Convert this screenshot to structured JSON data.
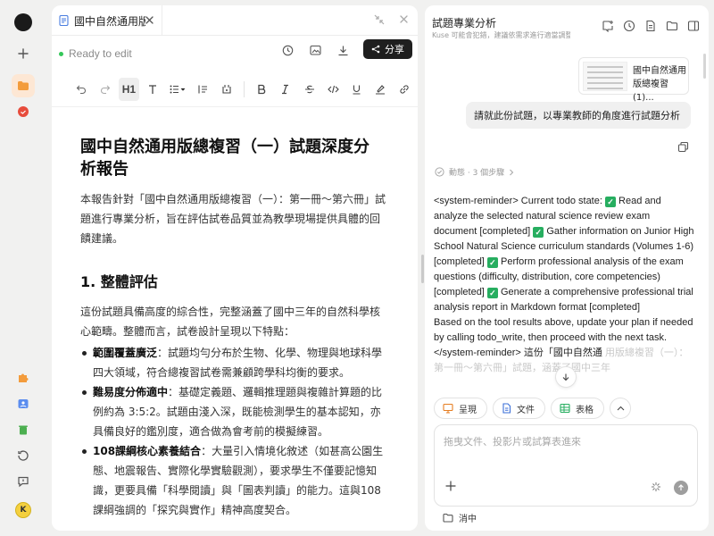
{
  "colors": {
    "accent_orange": "#f39c3c",
    "accent_red": "#e74c3c",
    "ready_green": "#34c759",
    "check_green": "#27ae60"
  },
  "rail": {
    "avatar_letter": "K"
  },
  "editor": {
    "tab_title": "國中自然通用版總複習（一）試題深度分析報告",
    "status": "Ready to edit",
    "share_label": "分享",
    "heading_selector": "H1",
    "doc": {
      "title": "國中自然通用版總複習（一）試題深度分析報告",
      "intro": "本報告針對「國中自然通用版總複習（一）：第一冊～第六冊」試題進行專業分析，旨在評估試卷品質並為教學現場提供具體的回饋建議。",
      "section1_title": "1. 整體評估",
      "section1_p": "這份試題具備高度的綜合性，完整涵蓋了國中三年的自然科學核心範疇。整體而言，試卷設計呈現以下特點：",
      "bullets": [
        {
          "bold": "範圍覆蓋廣泛",
          "text": "：試題均勻分布於生物、化學、物理與地球科學四大領域，符合總複習試卷需兼顧跨學科均衡的要求。"
        },
        {
          "bold": "難易度分佈適中",
          "text": "：基礎定義題、邏輯推理題與複雜計算題的比例約為 3:5:2。試題由淺入深，既能檢測學生的基本認知，亦具備良好的鑑別度，適合做為會考前的模擬練習。"
        },
        {
          "bold": "108課綱核心素養結合",
          "text": "：大量引入情境化敘述（如甚高公園生態、地震報告、實際化學實驗觀測），要求學生不僅要記憶知識，更要具備「科學閱讀」與「圖表判讀」的能力。這與108課綱強調的「探究與實作」精神高度契合。"
        }
      ]
    }
  },
  "chat": {
    "title": "試題專業分析",
    "subtitle": "Kuse 可能會犯錯，建議依需求進行適當調整",
    "file_name": "國中自然通用版總複習(1)...",
    "user_message": "請就此份試題，以專業教師的角度進行試題分析",
    "steps": "動態 · 3 個步驟",
    "reply": {
      "p1": "<system-reminder> Current todo state:",
      "t1": "Read and analyze the selected natural science review exam document [completed]",
      "t2": "Gather information on Junior High School Natural Science curriculum standards (Volumes 1-6) [completed]",
      "t3": "Perform professional analysis of the exam questions (difficulty, distribution, core competencies) [completed]",
      "t4": "Generate a comprehensive professional trial analysis report in Markdown format [completed]",
      "p2": "Based on the tool results above, update your plan if needed by calling todo_write, then proceed with the next task. </system-reminder> 這份「國中自然通",
      "p3": "用版總複習（一）：第一冊～第六冊」試題，涵蓋了國中三年"
    },
    "chips": [
      "呈現",
      "文件",
      "表格"
    ],
    "input_placeholder": "拖曳文件、投影片或試算表進來",
    "workspace": "消中"
  }
}
